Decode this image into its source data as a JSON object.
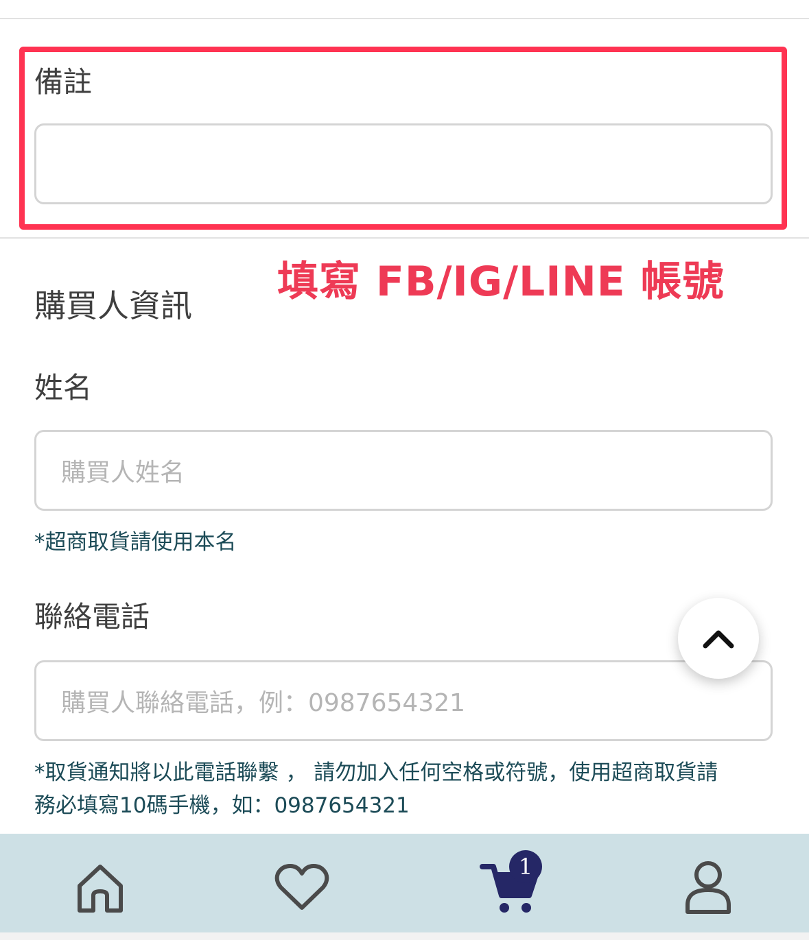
{
  "remarks": {
    "label": "備註",
    "value": ""
  },
  "annotation": "填寫 FB/IG/LINE 帳號",
  "buyer_section": {
    "title": "購買人資訊",
    "name": {
      "label": "姓名",
      "placeholder": "購買人姓名",
      "note": "*超商取貨請使用本名"
    },
    "phone": {
      "label": "聯絡電話",
      "placeholder": "購買人聯絡電話，例：0987654321",
      "note_line1": "*取貨通知將以此電話聯繫 ， 請勿加入任何空格或符號，使用超商取貨請",
      "note_line2": "務必填寫10碼手機，如：0987654321"
    }
  },
  "bottom_nav": {
    "items": [
      {
        "icon": "home-icon"
      },
      {
        "icon": "heart-icon"
      },
      {
        "icon": "cart-icon",
        "badge": "1"
      },
      {
        "icon": "user-icon"
      }
    ]
  },
  "colors": {
    "highlight": "#ff3352",
    "annotation": "#ee3a55",
    "nav_background": "#cde0e5",
    "cart": "#252766",
    "note_text": "#1c4b57"
  }
}
